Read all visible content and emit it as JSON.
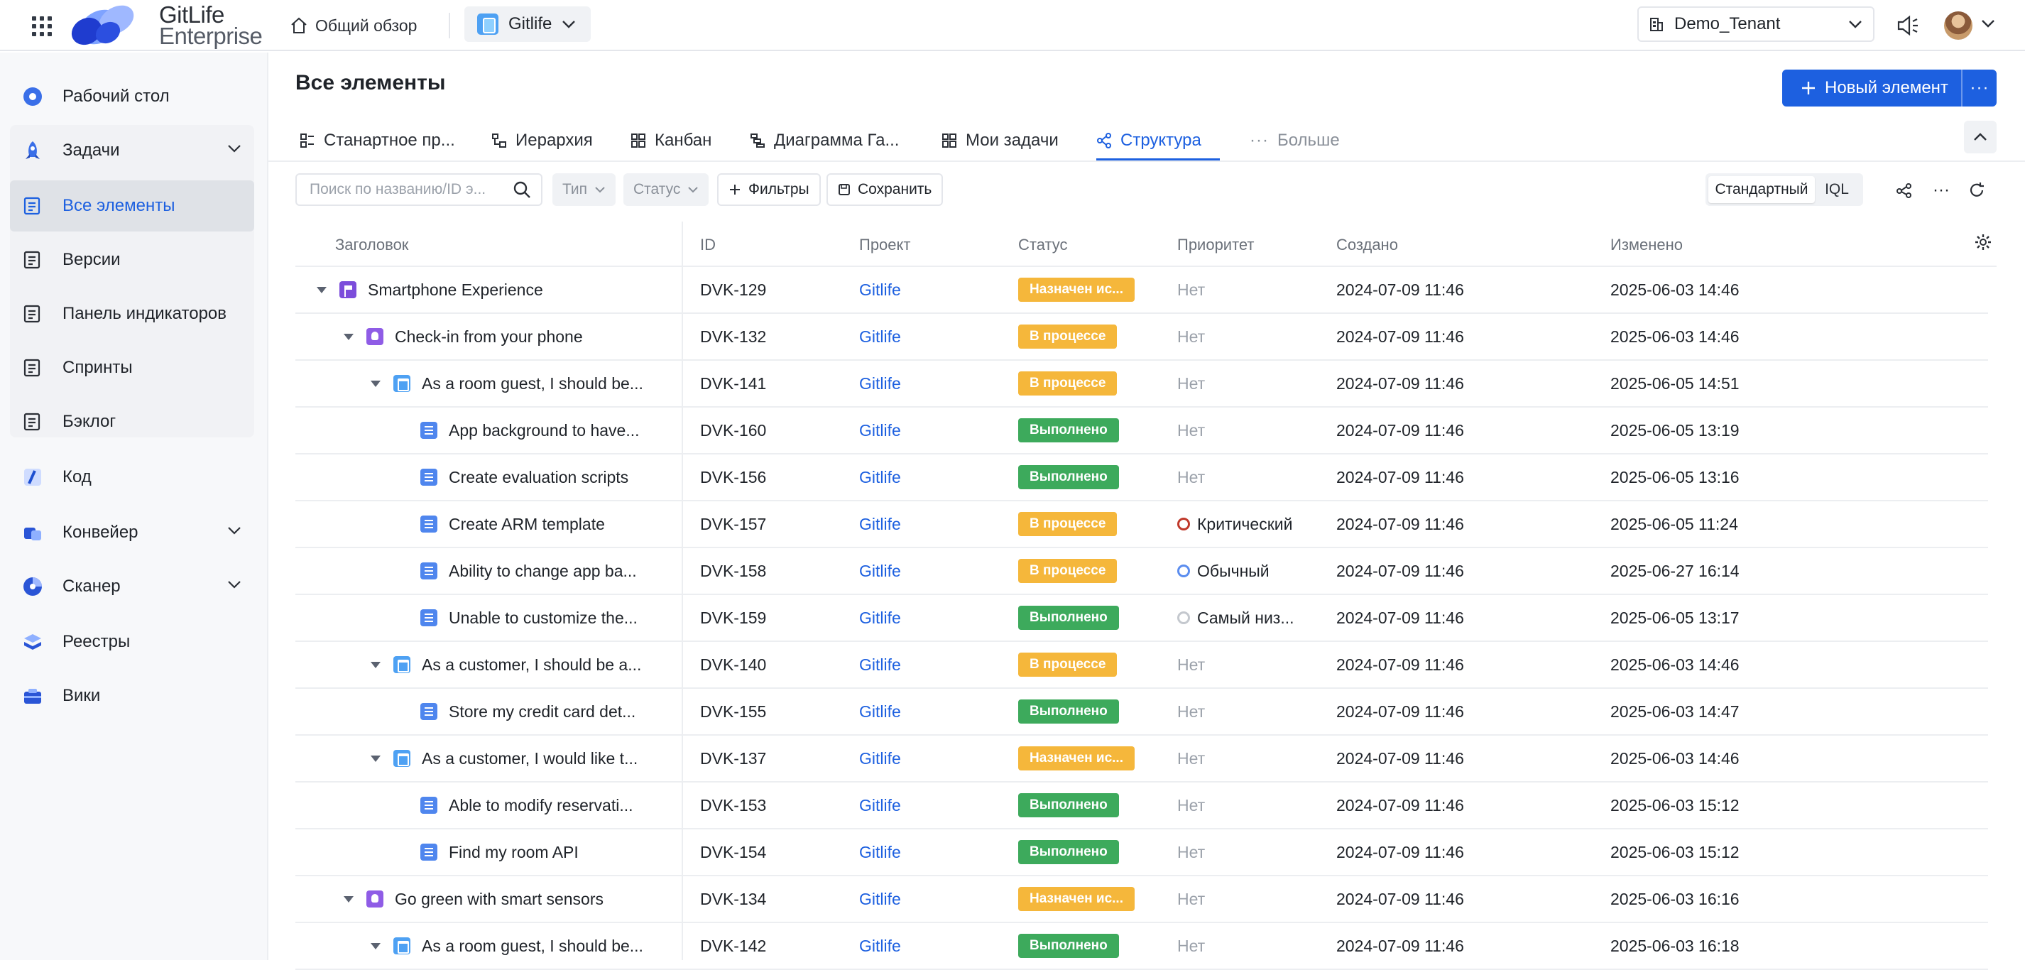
{
  "header": {
    "logo_line1": "GitLife",
    "logo_line2": "Enterprise",
    "overview_label": "Общий обзор",
    "project_name": "Gitlife",
    "tenant_name": "Demo_Tenant"
  },
  "sidebar": {
    "items": [
      {
        "label": "Рабочий стол",
        "icon": "dashboard-icon"
      },
      {
        "label": "Задачи",
        "icon": "rocket-icon"
      },
      {
        "label": "Все элементы",
        "icon": "list-icon"
      },
      {
        "label": "Версии",
        "icon": "list-icon"
      },
      {
        "label": "Панель индикаторов",
        "icon": "list-icon"
      },
      {
        "label": "Спринты",
        "icon": "list-icon"
      },
      {
        "label": "Бэклог",
        "icon": "list-icon"
      },
      {
        "label": "Код",
        "icon": "code-icon"
      },
      {
        "label": "Конвейер",
        "icon": "pipeline-icon"
      },
      {
        "label": "Сканер",
        "icon": "scanner-icon"
      },
      {
        "label": "Реестры",
        "icon": "registry-icon"
      },
      {
        "label": "Вики",
        "icon": "wiki-icon"
      }
    ]
  },
  "main": {
    "title": "Все элементы",
    "new_button_label": "Новый элемент",
    "more_label": "···",
    "tabs": [
      {
        "label": "Станартное пр..."
      },
      {
        "label": "Иерархия"
      },
      {
        "label": "Канбан"
      },
      {
        "label": "Диаграмма Га..."
      },
      {
        "label": "Мои задачи"
      },
      {
        "label": "Структура"
      },
      {
        "label": "Больше"
      }
    ],
    "filters": {
      "search_placeholder": "Поиск по названию/ID э...",
      "type_label": "Тип",
      "status_label": "Статус",
      "filters_label": "Фильтры",
      "save_label": "Сохранить",
      "mode_standard": "Стандартный",
      "mode_iql": "IQL"
    },
    "columns": [
      "Заголовок",
      "ID",
      "Проект",
      "Статус",
      "Приоритет",
      "Создано",
      "Изменено"
    ],
    "rows": [
      {
        "title": "Smartphone Experience",
        "id": "DVK-129",
        "project": "Gitlife",
        "status": "Назначен ис...",
        "priority": "Нет",
        "created": "2024-07-09 11:46",
        "modified": "2025-06-03 14:46"
      },
      {
        "title": "Check-in from your phone",
        "id": "DVK-132",
        "project": "Gitlife",
        "status": "В процессе",
        "priority": "Нет",
        "created": "2024-07-09 11:46",
        "modified": "2025-06-03 14:46"
      },
      {
        "title": "As a room guest, I should be...",
        "id": "DVK-141",
        "project": "Gitlife",
        "status": "В процессе",
        "priority": "Нет",
        "created": "2024-07-09 11:46",
        "modified": "2025-06-05 14:51"
      },
      {
        "title": "App background to have...",
        "id": "DVK-160",
        "project": "Gitlife",
        "status": "Выполнено",
        "priority": "Нет",
        "created": "2024-07-09 11:46",
        "modified": "2025-06-05 13:19"
      },
      {
        "title": "Create evaluation scripts",
        "id": "DVK-156",
        "project": "Gitlife",
        "status": "Выполнено",
        "priority": "Нет",
        "created": "2024-07-09 11:46",
        "modified": "2025-06-05 13:16"
      },
      {
        "title": "Create ARM template",
        "id": "DVK-157",
        "project": "Gitlife",
        "status": "В процессе",
        "priority": "Критический",
        "created": "2024-07-09 11:46",
        "modified": "2025-06-05 11:24"
      },
      {
        "title": "Ability to change app ba...",
        "id": "DVK-158",
        "project": "Gitlife",
        "status": "В процессе",
        "priority": "Обычный",
        "created": "2024-07-09 11:46",
        "modified": "2025-06-27 16:14"
      },
      {
        "title": "Unable to customize the...",
        "id": "DVK-159",
        "project": "Gitlife",
        "status": "Выполнено",
        "priority": "Самый низ...",
        "created": "2024-07-09 11:46",
        "modified": "2025-06-05 13:17"
      },
      {
        "title": "As a customer, I should be a...",
        "id": "DVK-140",
        "project": "Gitlife",
        "status": "В процессе",
        "priority": "Нет",
        "created": "2024-07-09 11:46",
        "modified": "2025-06-03 14:46"
      },
      {
        "title": "Store my credit card det...",
        "id": "DVK-155",
        "project": "Gitlife",
        "status": "Выполнено",
        "priority": "Нет",
        "created": "2024-07-09 11:46",
        "modified": "2025-06-03 14:47"
      },
      {
        "title": "As a customer, I would like t...",
        "id": "DVK-137",
        "project": "Gitlife",
        "status": "Назначен ис...",
        "priority": "Нет",
        "created": "2024-07-09 11:46",
        "modified": "2025-06-03 14:46"
      },
      {
        "title": "Able to modify reservati...",
        "id": "DVK-153",
        "project": "Gitlife",
        "status": "Выполнено",
        "priority": "Нет",
        "created": "2024-07-09 11:46",
        "modified": "2025-06-03 15:12"
      },
      {
        "title": "Find my room API",
        "id": "DVK-154",
        "project": "Gitlife",
        "status": "Выполнено",
        "priority": "Нет",
        "created": "2024-07-09 11:46",
        "modified": "2025-06-03 15:12"
      },
      {
        "title": "Go green with smart sensors",
        "id": "DVK-134",
        "project": "Gitlife",
        "status": "Назначен ис...",
        "priority": "Нет",
        "created": "2024-07-09 11:46",
        "modified": "2025-06-03 16:16"
      },
      {
        "title": "As a room guest, I should be...",
        "id": "DVK-142",
        "project": "Gitlife",
        "status": "Выполнено",
        "priority": "Нет",
        "created": "2024-07-09 11:46",
        "modified": "2025-06-03 16:18"
      }
    ]
  },
  "colors": {
    "accent": "#1d60e0",
    "status_assigned": "#f5b73b",
    "status_in_progress": "#f5b73b",
    "status_done": "#3daa5c",
    "priority_critical": "#c0392b",
    "priority_normal": "#5b8def",
    "priority_lowest": "#c4c8ce"
  }
}
